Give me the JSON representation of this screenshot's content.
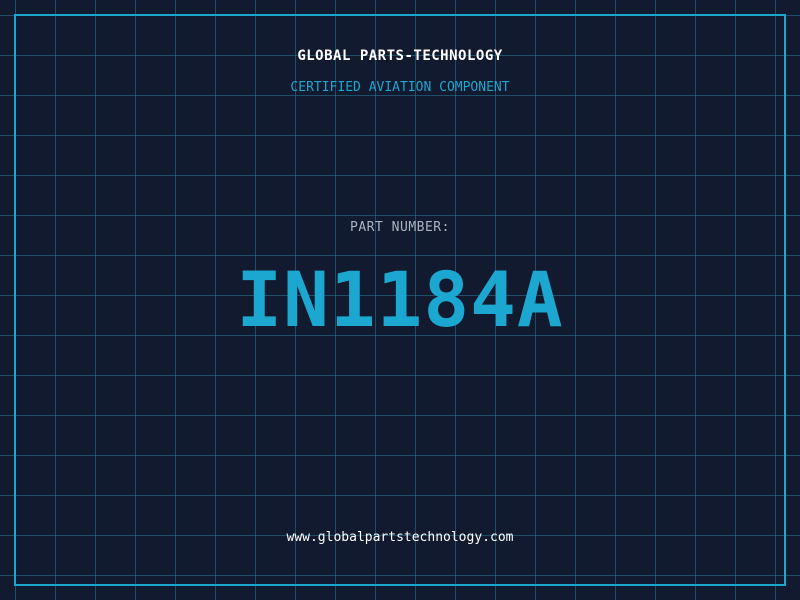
{
  "header": {
    "company_name": "GLOBAL PARTS-TECHNOLOGY",
    "tagline": "CERTIFIED AVIATION COMPONENT"
  },
  "part": {
    "label": "PART NUMBER:",
    "number": "IN1184A"
  },
  "footer": {
    "website": "www.globalpartstechnology.com"
  },
  "colors": {
    "background": "#111a2e",
    "grid": "#287896",
    "accent": "#1ba7d0",
    "text_primary": "#ffffff",
    "text_muted": "#aab4c2"
  }
}
